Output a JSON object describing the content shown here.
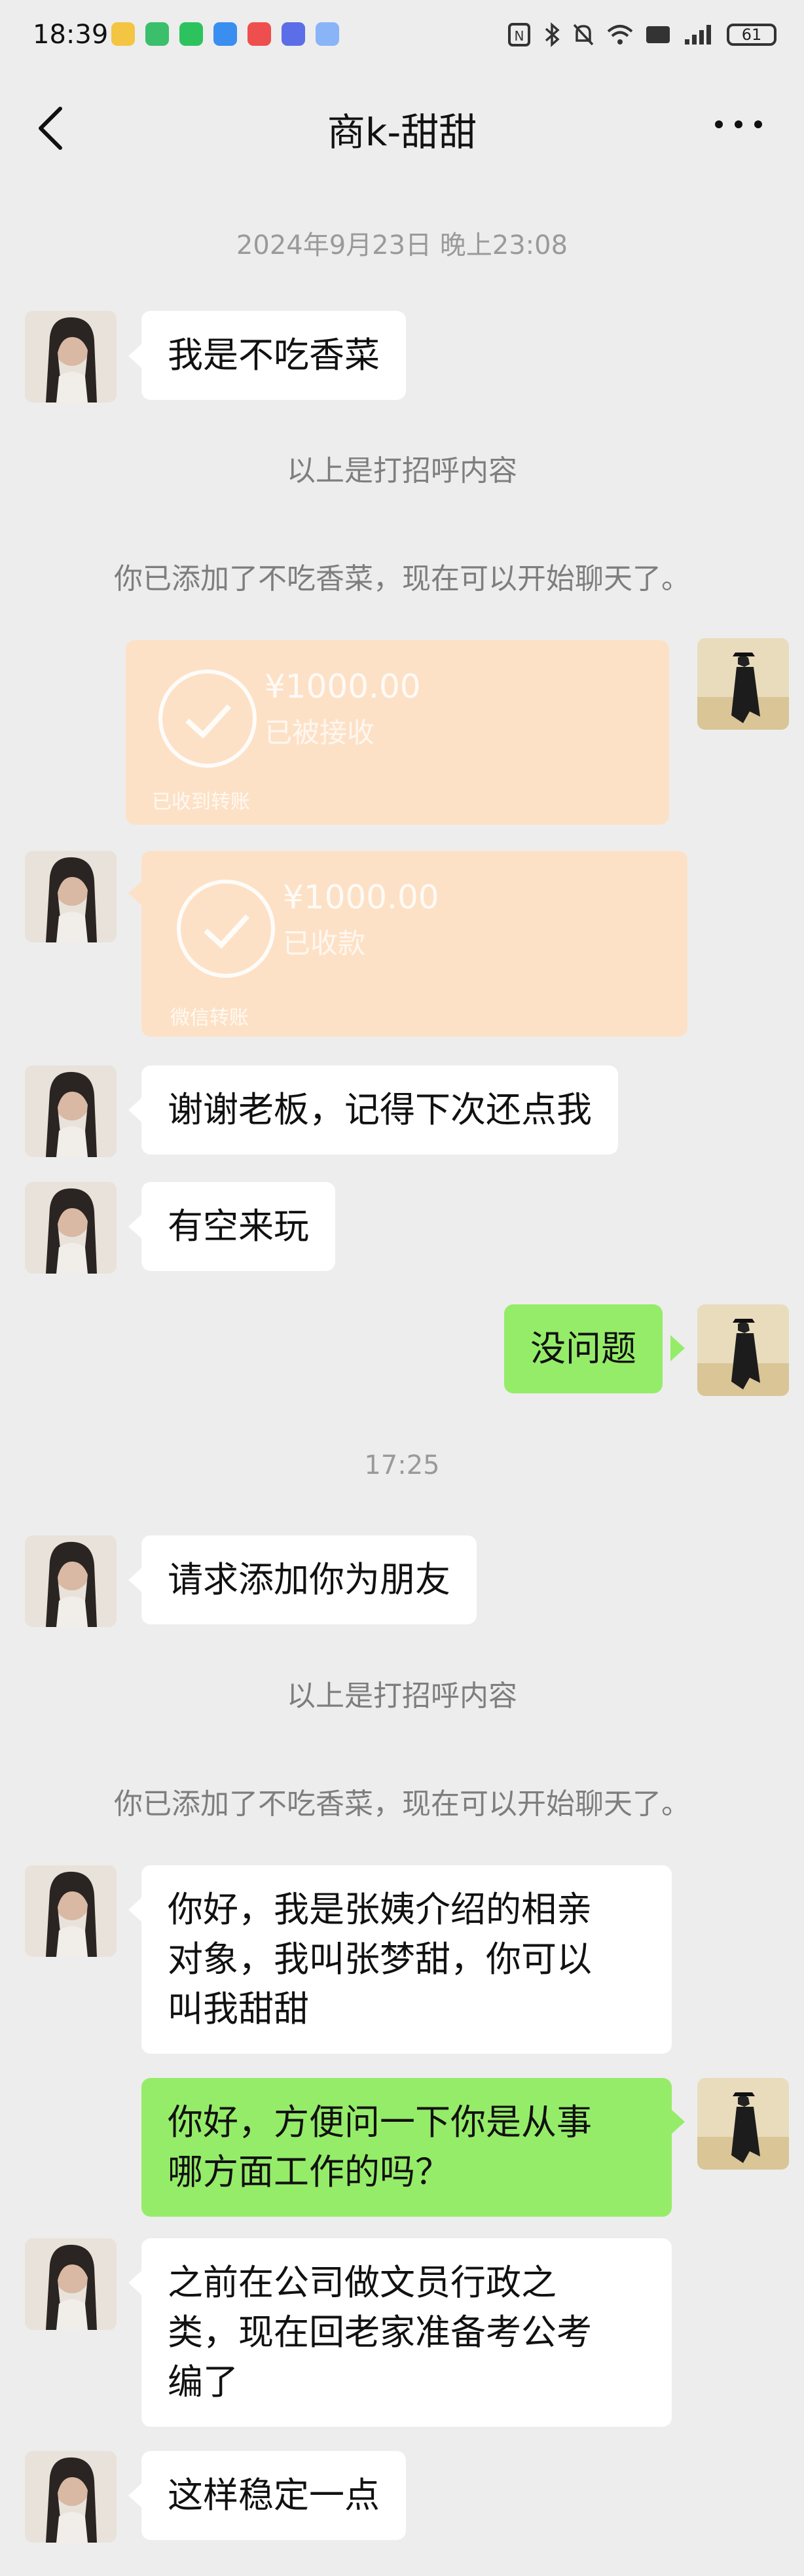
{
  "status_bar": {
    "time": "18:39",
    "battery": "61"
  },
  "header": {
    "title": "商k-甜甜"
  },
  "messages": {
    "timestamp1": "2024年9月23日 晚上23:08",
    "m1": "我是不吃香菜",
    "greeting_note": "以上是打招呼内容",
    "added_note": "你已添加了不吃香菜，现在可以开始聊天了。",
    "transfer1": {
      "amount": "¥1000.00",
      "status": "已被接收",
      "footer": "已收到转账"
    },
    "transfer2": {
      "amount": "¥1000.00",
      "status": "已收款",
      "footer": "微信转账"
    },
    "m2": "谢谢老板，记得下次还点我",
    "m3": "有空来玩",
    "m4": "没问题",
    "timestamp2": "17:25",
    "m5": "请求添加你为朋友",
    "greeting_note2": "以上是打招呼内容",
    "added_note2": "你已添加了不吃香菜，现在可以开始聊天了。",
    "m6_l1": "你好，我是张姨介绍的相亲",
    "m6_l2": "对象，我叫张梦甜，你可以",
    "m6_l3": "叫我甜甜",
    "m7_l1": "你好，方便问一下你是从事",
    "m7_l2": "哪方面工作的吗？",
    "m8_l1": "之前在公司做文员行政之",
    "m8_l2": "类，现在回老家准备考公考",
    "m8_l3": "编了",
    "m9": "这样稳定一点"
  },
  "colors": {
    "background": "#ededed",
    "bubble_self": "#95ec69",
    "bubble_other": "#ffffff",
    "transfer": "#fde1c6"
  },
  "icons": [
    "back-icon",
    "more-icon",
    "check-icon",
    "signal-icon",
    "wifi-icon",
    "bluetooth-icon",
    "mute-icon",
    "nfc-icon"
  ]
}
